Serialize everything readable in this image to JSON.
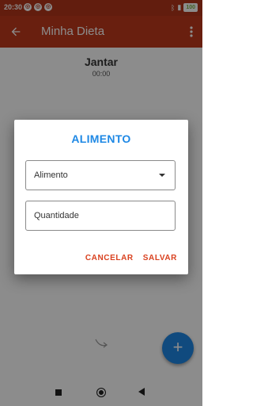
{
  "status_bar": {
    "time": "20:30",
    "battery": "100"
  },
  "app_bar": {
    "title": "Minha Dieta"
  },
  "meal": {
    "title": "Jantar",
    "time": "00:00"
  },
  "dialog": {
    "title": "ALIMENTO",
    "food_select_value": "Alimento",
    "quantity_placeholder": "Quantidade",
    "cancel_label": "CANCELAR",
    "save_label": "SALVAR"
  },
  "fab": {
    "label": "+"
  },
  "icons": [
    "back-arrow-icon",
    "more-vert-icon",
    "dropdown-arrow-icon",
    "add-icon",
    "swipe-icon",
    "bluetooth-icon",
    "battery-icon",
    "nav-stop-icon",
    "nav-home-icon",
    "nav-back-icon"
  ],
  "colors": {
    "primary": "#bf3a1c",
    "accent": "#1e88e5",
    "action": "#d9411f"
  }
}
